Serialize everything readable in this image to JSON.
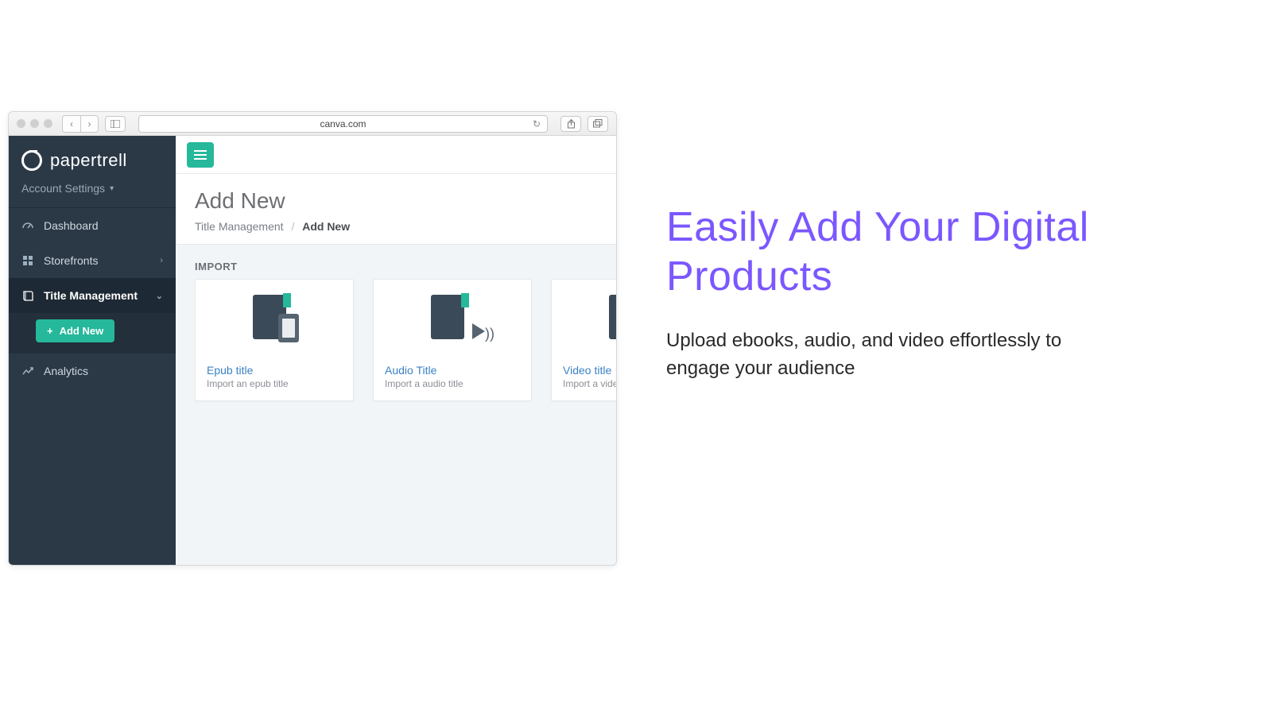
{
  "browser": {
    "url": "canva.com"
  },
  "brand": {
    "name": "papertrell"
  },
  "account": {
    "label": "Account Settings"
  },
  "sidebar": {
    "items": [
      {
        "label": "Dashboard"
      },
      {
        "label": "Storefronts"
      },
      {
        "label": "Title Management"
      },
      {
        "label": "Analytics"
      }
    ],
    "add_new_label": "Add New"
  },
  "page": {
    "title": "Add New",
    "breadcrumb_root": "Title Management",
    "breadcrumb_current": "Add New",
    "section_label": "IMPORT"
  },
  "cards": [
    {
      "title": "Epub title",
      "subtitle": "Import an epub title"
    },
    {
      "title": "Audio Title",
      "subtitle": "Import a audio title"
    },
    {
      "title": "Video title",
      "subtitle": "Import a video title"
    }
  ],
  "promo": {
    "headline": "Easily Add Your Digital Products",
    "body": "Upload ebooks, audio, and video effortlessly to engage your audience"
  },
  "colors": {
    "accent": "#25b89a",
    "sidebar": "#2b3947",
    "link": "#3b82c4",
    "promo": "#7b57ff"
  }
}
